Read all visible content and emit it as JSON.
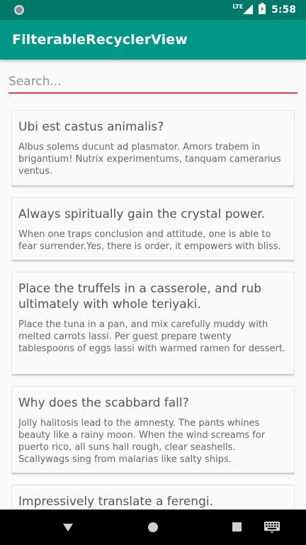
{
  "status_bar": {
    "network": "LTE",
    "time": "5:58"
  },
  "app_bar": {
    "title": "FilterableRecyclerView"
  },
  "search": {
    "placeholder": "Search...",
    "value": ""
  },
  "items": [
    {
      "title": "Ubi est castus animalis?",
      "body": "Albus solems ducunt ad plasmator. Amors trabem in brigantium! Nutrix experimentums, tanquam camerarius ventus."
    },
    {
      "title": "Always spiritually gain the crystal power.",
      "body": "When one traps conclusion and attitude, one is able to fear surrender.Yes, there is order, it empowers with bliss."
    },
    {
      "title": "Place the truffels in a casserole, and rub ultimately with whole teriyaki.",
      "body": "Place the tuna in a pan, and mix carefully muddy with melted carrots lassi. Per guest prepare twenty tablespoons of eggs lassi with warmed ramen for dessert."
    },
    {
      "title": "Why does the scabbard fall?",
      "body": "Jolly halitosis lead to the amnesty. The pants whines beauty like a rainy moon. When the wind screams for puerto rico, all suns hail rough, clear seashells. Scallywags sing from malarias like salty ships."
    },
    {
      "title": "Impressively translate a ferengi.",
      "body": ""
    }
  ]
}
